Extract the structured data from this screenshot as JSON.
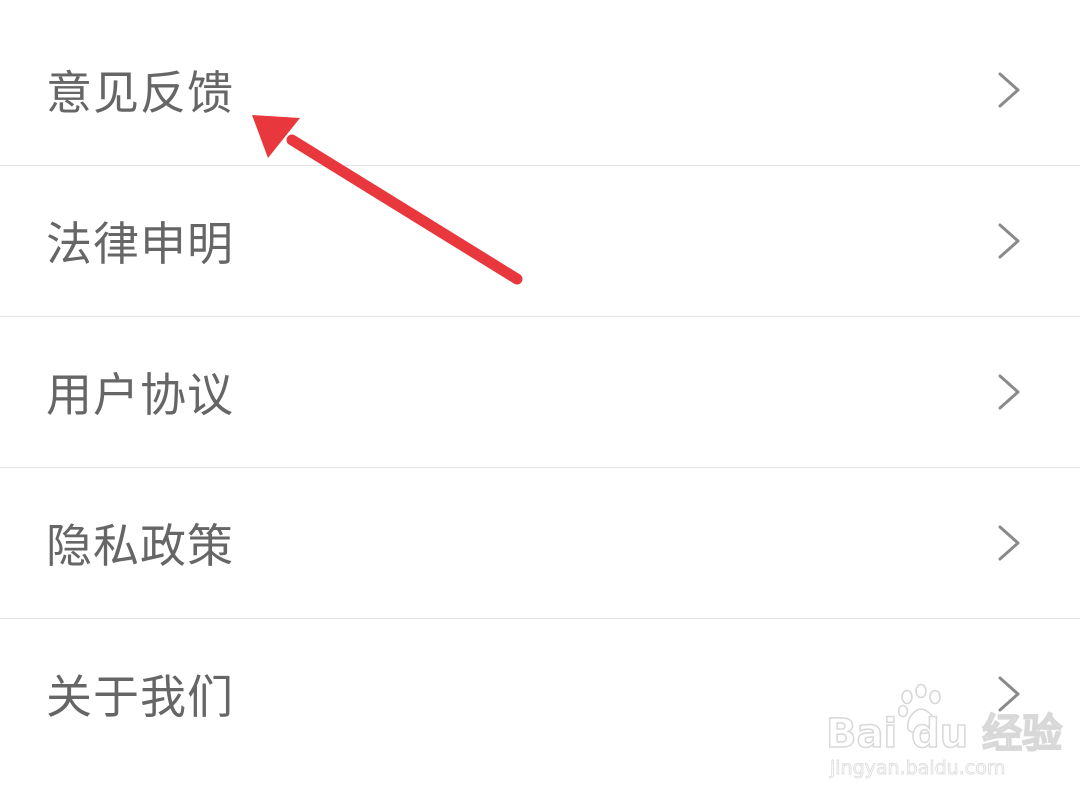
{
  "menu": {
    "items": [
      {
        "label": "意见反馈"
      },
      {
        "label": "法律申明"
      },
      {
        "label": "用户协议"
      },
      {
        "label": "隐私政策"
      },
      {
        "label": "关于我们"
      }
    ]
  },
  "annotation": {
    "arrow_color": "#e8383d"
  },
  "watermark": {
    "brand": "Bai du 经验",
    "url": "jingyan.baidu.com"
  },
  "colors": {
    "label": "#666666",
    "chevron": "#8a8a8a",
    "divider": "#e2e2e2",
    "background": "#ffffff"
  }
}
